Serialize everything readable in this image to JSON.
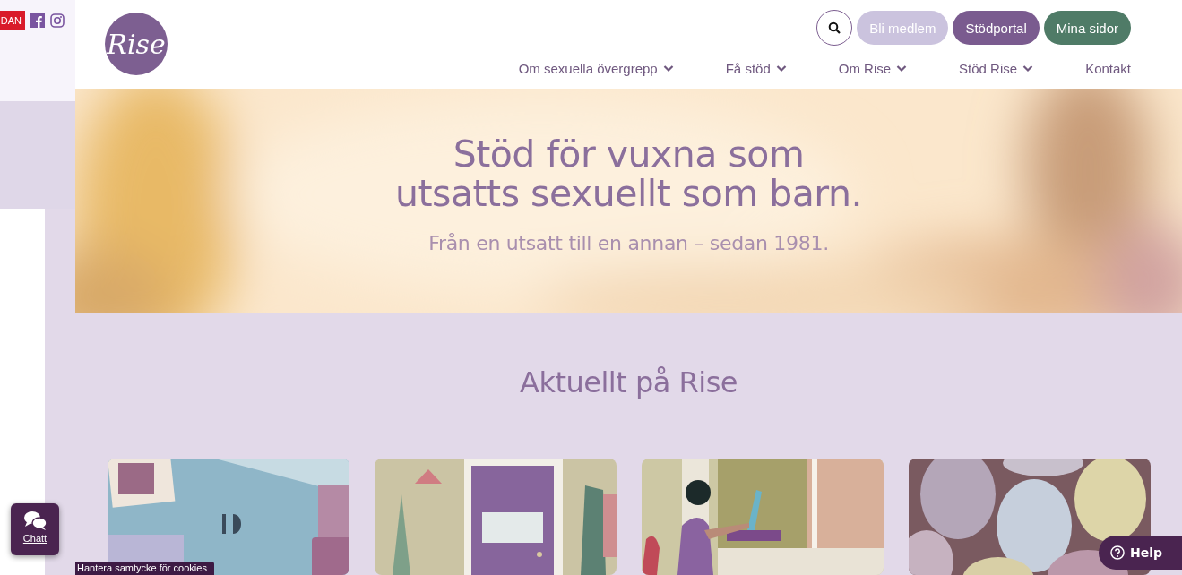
{
  "topbar": {
    "badge": "DAN"
  },
  "header": {
    "logo": "Rise",
    "buttons": [
      {
        "label": "Bli medlem",
        "color": "#cbc3de"
      },
      {
        "label": "Stödportal",
        "color": "#7a5b8f"
      },
      {
        "label": "Mina sidor",
        "color": "#4f7b67"
      }
    ],
    "nav": [
      {
        "label": "Om sexuella övergrepp",
        "dropdown": true
      },
      {
        "label": "Få stöd",
        "dropdown": true
      },
      {
        "label": "Om Rise",
        "dropdown": true
      },
      {
        "label": "Stöd Rise",
        "dropdown": true
      },
      {
        "label": "Kontakt",
        "dropdown": false
      }
    ]
  },
  "hero": {
    "title_lines": [
      "Stöd för vuxna som",
      "utsatts sexuellt som barn."
    ],
    "subtitle": "Från en utsatt till en annan – sedan 1981."
  },
  "news": {
    "heading": "Aktuellt på Rise"
  },
  "chat": {
    "label": "Chatt"
  },
  "cookie": {
    "label": "Hantera samtycke för cookies"
  },
  "help": {
    "label": "Help"
  }
}
